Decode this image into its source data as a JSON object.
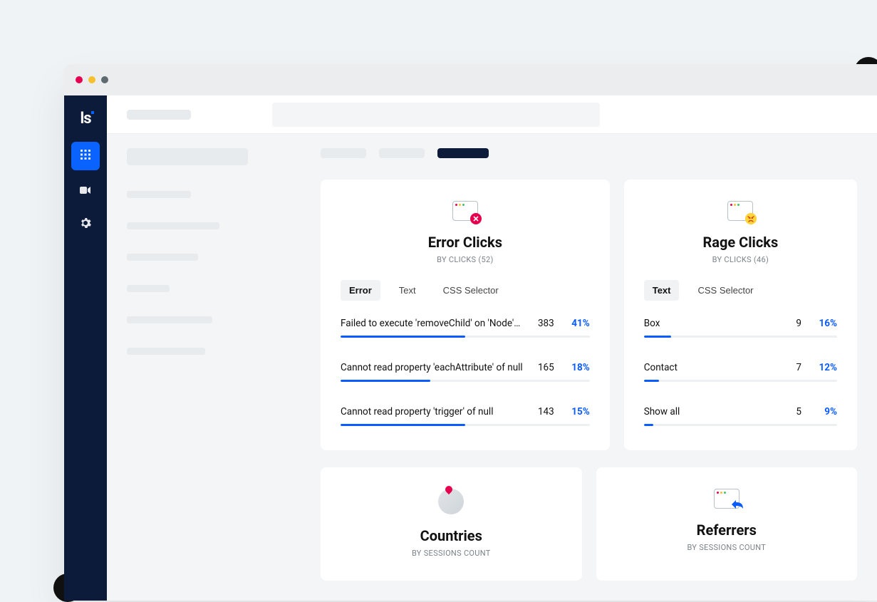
{
  "brand": "ls",
  "cards": {
    "error_clicks": {
      "title": "Error Clicks",
      "subtitle": "BY CLICKS (52)",
      "filter_tabs": [
        "Error",
        "Text",
        "CSS Selector"
      ],
      "active_filter_index": 0,
      "rows": [
        {
          "label": "Failed to execute 'removeChild' on 'Node'…",
          "count": "383",
          "pct": "41%",
          "bar": 50
        },
        {
          "label": "Cannot read property 'eachAttribute' of null",
          "count": "165",
          "pct": "18%",
          "bar": 36
        },
        {
          "label": "Cannot read property 'trigger' of null",
          "count": "143",
          "pct": "15%",
          "bar": 50
        }
      ]
    },
    "rage_clicks": {
      "title": "Rage Clicks",
      "subtitle": "BY CLICKS (46)",
      "filter_tabs": [
        "Text",
        "CSS Selector"
      ],
      "active_filter_index": 0,
      "rows": [
        {
          "label": "Box",
          "count": "9",
          "pct": "16%",
          "bar": 14
        },
        {
          "label": "Contact",
          "count": "7",
          "pct": "12%",
          "bar": 8
        },
        {
          "label": "Show all",
          "count": "5",
          "pct": "9%",
          "bar": 5
        }
      ]
    },
    "countries": {
      "title": "Countries",
      "subtitle": "BY SESSIONS COUNT"
    },
    "referrers": {
      "title": "Referrers",
      "subtitle": "BY SESSIONS COUNT"
    }
  }
}
